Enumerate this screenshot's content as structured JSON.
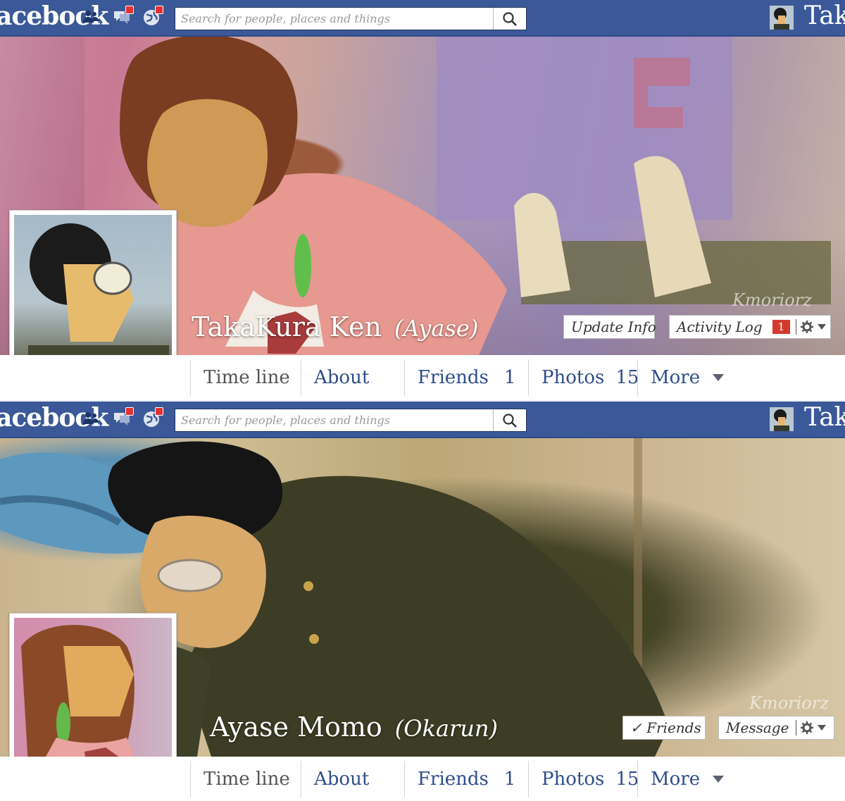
{
  "header": {
    "brand": "acebook",
    "search_placeholder": "Search for people, places and things",
    "user_name": "Tak"
  },
  "profiles": [
    {
      "name": "TakaKura Ken",
      "alias": "(Ayase)",
      "signature": "Kmoriorz",
      "actions": {
        "primary": "Update Info",
        "secondary": "Activity Log",
        "secondary_count": "1"
      },
      "tabs": {
        "timeline": "Time line",
        "about": "About",
        "friends": "Friends",
        "friends_count": "1",
        "photos": "Photos",
        "photos_count": "15",
        "more": "More"
      }
    },
    {
      "name": "Ayase Momo",
      "alias": "(Okarun)",
      "signature": "Kmoriorz",
      "actions": {
        "primary": "✓ Friends",
        "secondary": "Message"
      },
      "tabs": {
        "timeline": "Time line",
        "about": "About",
        "friends": "Friends",
        "friends_count": "1",
        "photos": "Photos",
        "photos_count": "15",
        "more": "More"
      }
    }
  ],
  "colors": {
    "bar": "#3b5998",
    "link": "#2f4d8a",
    "badge": "#d33b2c"
  }
}
